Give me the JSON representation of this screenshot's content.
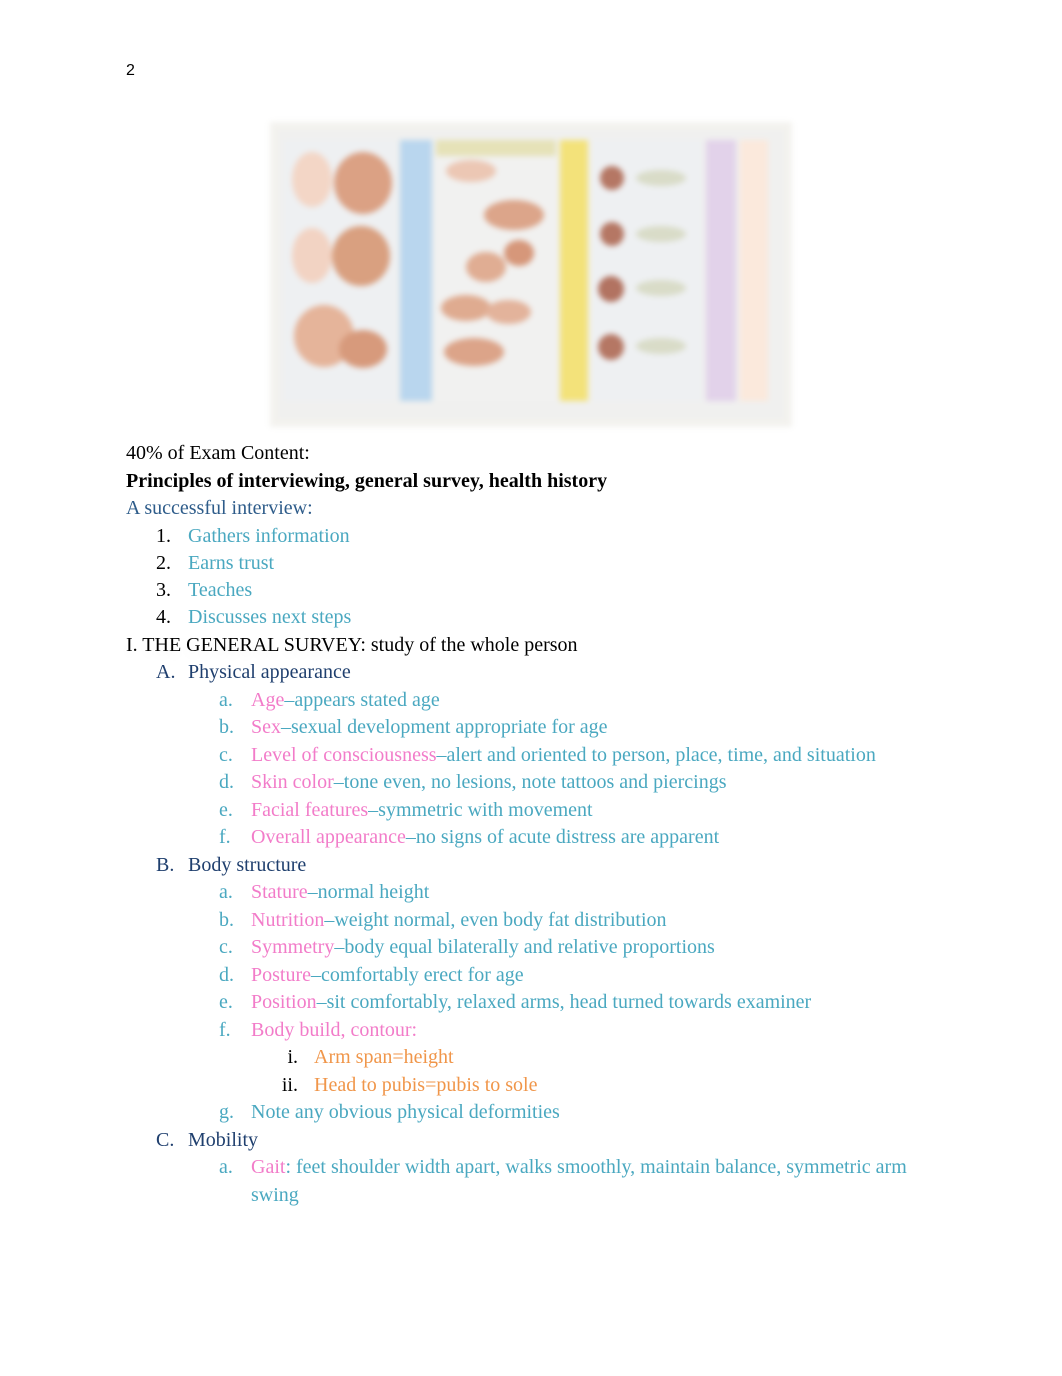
{
  "page": {
    "number": "2"
  },
  "figure": {
    "description": "blurred anatomical reference chart",
    "column_colors": [
      "#b9d6ee",
      "#f3e27a",
      "#e2d2ea",
      "#fbe9dc"
    ]
  },
  "intro": {
    "exam_content": "40% of Exam Content:",
    "heading": "Principles of interviewing, general survey, health history",
    "subheading": "A successful interview:"
  },
  "interview_list": [
    {
      "marker": "1.",
      "text": "Gathers information"
    },
    {
      "marker": "2.",
      "text": "Earns trust"
    },
    {
      "marker": "3.",
      "text": "Teaches"
    },
    {
      "marker": "4.",
      "text": "Discusses next steps"
    }
  ],
  "general_survey": {
    "title": "I. THE GENERAL SURVEY",
    "title_suffix": ": study of the whole person",
    "sections": [
      {
        "marker": "A.",
        "title": "Physical appearance",
        "items": [
          {
            "marker": "a.",
            "term": "Age",
            "desc": "–appears stated age"
          },
          {
            "marker": "b.",
            "term": "Sex",
            "desc": "–sexual development appropriate for age"
          },
          {
            "marker": "c.",
            "term": "Level of consciousness",
            "desc": "–alert and oriented to person, place, time, and situation"
          },
          {
            "marker": "d.",
            "term": "Skin color",
            "desc": "–tone even, no lesions, note tattoos and piercings"
          },
          {
            "marker": "e.",
            "term": "Facial features",
            "desc": "–symmetric with movement"
          },
          {
            "marker": "f.",
            "term": "Overall appearance",
            "desc": "–no signs of acute distress are apparent"
          }
        ]
      },
      {
        "marker": "B.",
        "title": "Body structure",
        "items": [
          {
            "marker": "a.",
            "term": "Stature",
            "desc": "–normal height"
          },
          {
            "marker": "b.",
            "term": "Nutrition",
            "desc": "–weight normal, even body fat distribution"
          },
          {
            "marker": "c.",
            "term": "Symmetry",
            "desc": "–body equal bilaterally and relative proportions"
          },
          {
            "marker": "d.",
            "term": "Posture",
            "desc": "–comfortably erect for age"
          },
          {
            "marker": "e.",
            "term": "Position",
            "desc": "–sit comfortably, relaxed arms, head turned towards examiner"
          },
          {
            "marker": "f.",
            "term": "Body build, contour:",
            "desc": "",
            "subitems": [
              {
                "marker": "i.",
                "text": "Arm span=height"
              },
              {
                "marker": "ii.",
                "text": "Head to pubis=pubis to sole"
              }
            ]
          },
          {
            "marker": "g.",
            "term": "",
            "desc": "Note any obvious physical deformities"
          }
        ]
      },
      {
        "marker": "C.",
        "title": "Mobility",
        "items": [
          {
            "marker": "a.",
            "term": "Gait",
            "desc": ": feet shoulder width apart, walks smoothly, maintain balance, symmetric arm",
            "desc_cont": "swing"
          }
        ]
      }
    ]
  }
}
